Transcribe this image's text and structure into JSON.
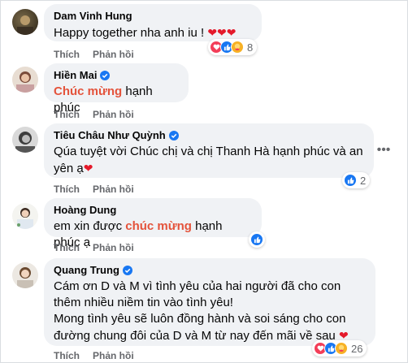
{
  "actions": {
    "like": "Thích",
    "reply": "Phản hồi"
  },
  "comments": [
    {
      "author": "Dam Vinh Hung",
      "text": "Happy together nha anh iu !",
      "hearts": "❤❤❤",
      "reaction_count": "8",
      "reactions": [
        "love-icon",
        "like-icon",
        "care-icon"
      ]
    },
    {
      "author": "Hiền Mai",
      "hl": "Chúc mừng",
      "text_after": " hạnh phúc"
    },
    {
      "author": "Tiêu Châu Như Quỳnh",
      "line1": "Qúa tuyệt vời Chúc chị và chị Thanh Hà hạnh phúc và an",
      "line2": "yên ạ",
      "reaction_count": "2",
      "reactions": [
        "like-icon"
      ]
    },
    {
      "author": "Hoàng Dung",
      "text_before": "em xin được ",
      "hl": "chúc mừng",
      "text_after": " hạnh phúc ạ",
      "reactions": [
        "like-icon"
      ]
    },
    {
      "author": "Quang Trung",
      "line1": "Cám ơn D và M vì tình yêu của hai người đã cho con",
      "line2": "thêm nhiều niềm tin vào tình yêu!",
      "line3": "Mong tình yêu sẽ luôn đồng hành và soi sáng cho con",
      "line4": "đường chung đôi của D và M từ nay đến mãi về sau",
      "reaction_count": "26",
      "reactions": [
        "love-icon",
        "like-icon",
        "care-icon"
      ]
    }
  ],
  "colors": {
    "accent_blue": "#1877f2",
    "highlight": "#e4533b",
    "love": "#f33e58",
    "care": "#f7b125",
    "muted": "#65676b"
  }
}
